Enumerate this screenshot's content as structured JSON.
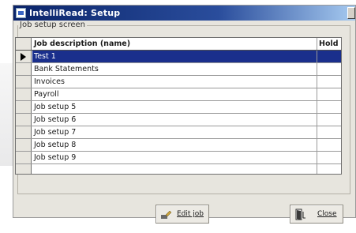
{
  "window": {
    "title": "IntelliRead: Setup"
  },
  "group": {
    "label": "Job setup screen"
  },
  "table": {
    "columns": [
      "Job description (name)",
      "Hold"
    ],
    "rows": [
      {
        "name": "Test 1",
        "hold": "",
        "selected": true
      },
      {
        "name": "Bank Statements",
        "hold": ""
      },
      {
        "name": "Invoices",
        "hold": ""
      },
      {
        "name": "Payroll",
        "hold": ""
      },
      {
        "name": "Job setup 5",
        "hold": ""
      },
      {
        "name": "Job setup 6",
        "hold": ""
      },
      {
        "name": "Job setup 7",
        "hold": ""
      },
      {
        "name": "Job setup 8",
        "hold": ""
      },
      {
        "name": "Job setup 9",
        "hold": ""
      }
    ]
  },
  "buttons": {
    "edit_job": "Edit job",
    "close": "Close"
  },
  "colors": {
    "titlebar": "#0a246a",
    "selection": "#1a2f8c",
    "window_bg": "#e7e5de"
  }
}
